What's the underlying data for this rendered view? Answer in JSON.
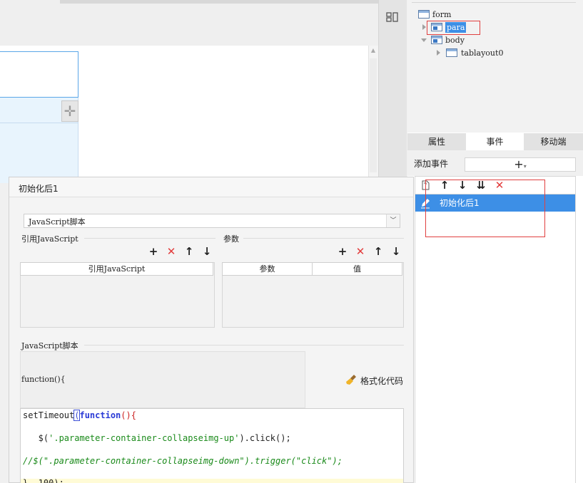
{
  "tree": {
    "items": [
      {
        "label": "form",
        "icon": "layout-icon"
      },
      {
        "label": "para",
        "icon": "para-widget-icon",
        "selected": true
      },
      {
        "label": "body",
        "icon": "layout-icon"
      },
      {
        "label": "tablayout0",
        "icon": "layout-icon"
      }
    ]
  },
  "panel": {
    "tabs": [
      {
        "label": "属性",
        "active": false
      },
      {
        "label": "事件",
        "active": true
      },
      {
        "label": "移动端",
        "active": false
      }
    ],
    "add_event_label": "添加事件",
    "add_event_btn": "+",
    "events": [
      {
        "label": "初始化后1",
        "selected": true
      }
    ]
  },
  "dialog": {
    "title": "初始化后1",
    "type_select": {
      "value": "JavaScript脚本"
    },
    "ref_js": {
      "title": "引用JavaScript",
      "column": "引用JavaScript"
    },
    "params": {
      "title": "参数",
      "columns": [
        "参数",
        "值"
      ]
    },
    "script_title": "JavaScript脚本",
    "function_header": "function(){",
    "format_label": "格式化代码",
    "code": {
      "line1_a": "setTimeout",
      "line1_b": "(",
      "line1_c": "function",
      "line1_d": "(){",
      "line2_a": "   $(",
      "line2_b": "'.parameter-container-collapseimg-up'",
      "line2_c": ").click();",
      "line3": "//$(\".parameter-container-collapseimg-down\").trigger(\"click\");",
      "line4": "}, 100);"
    }
  },
  "colors": {
    "accent": "#3d8fe6",
    "annotation": "#e04040",
    "delete": "#e23b3b"
  }
}
